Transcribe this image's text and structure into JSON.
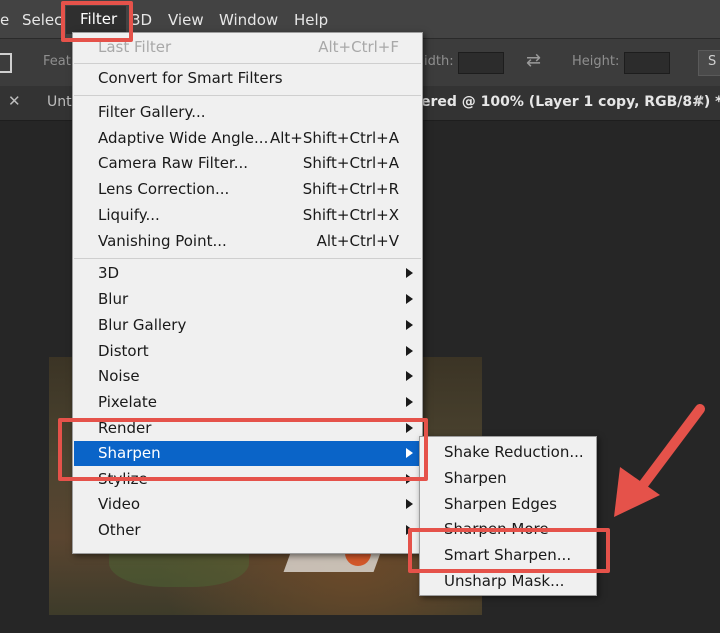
{
  "menubar": {
    "items": [
      "e",
      "Selec",
      "Filter",
      "3D",
      "View",
      "Window",
      "Help"
    ]
  },
  "optionsbar": {
    "feather_label": "Feath",
    "width_label": "idth:",
    "height_label": "Height:",
    "right_button": "S"
  },
  "tabs": {
    "tab1": "Unt",
    "tab2": "ered @ 100% (Layer 1 copy, RGB/8#) *"
  },
  "filter_menu": {
    "items": [
      {
        "label": "Last Filter",
        "shortcut": "Alt+Ctrl+F",
        "disabled": true
      },
      {
        "label": "Convert for Smart Filters",
        "shortcut": ""
      },
      {
        "label": "Filter Gallery...",
        "shortcut": ""
      },
      {
        "label": "Adaptive Wide Angle...",
        "shortcut": "Alt+Shift+Ctrl+A"
      },
      {
        "label": "Camera Raw Filter...",
        "shortcut": "Shift+Ctrl+A"
      },
      {
        "label": "Lens Correction...",
        "shortcut": "Shift+Ctrl+R"
      },
      {
        "label": "Liquify...",
        "shortcut": "Shift+Ctrl+X"
      },
      {
        "label": "Vanishing Point...",
        "shortcut": "Alt+Ctrl+V"
      },
      {
        "label": "3D",
        "submenu": true
      },
      {
        "label": "Blur",
        "submenu": true
      },
      {
        "label": "Blur Gallery",
        "submenu": true
      },
      {
        "label": "Distort",
        "submenu": true
      },
      {
        "label": "Noise",
        "submenu": true
      },
      {
        "label": "Pixelate",
        "submenu": true
      },
      {
        "label": "Render",
        "submenu": true
      },
      {
        "label": "Sharpen",
        "submenu": true,
        "selected": true
      },
      {
        "label": "Stylize",
        "submenu": true
      },
      {
        "label": "Video",
        "submenu": true
      },
      {
        "label": "Other",
        "submenu": true
      }
    ]
  },
  "sharpen_submenu": {
    "items": [
      "Shake Reduction...",
      "Sharpen",
      "Sharpen Edges",
      "Sharpen More",
      "Smart Sharpen...",
      "Unsharp Mask..."
    ]
  },
  "colors": {
    "highlight": "#e5524a",
    "selection": "#0a64c8",
    "menu_bg": "#f0f0f0"
  }
}
